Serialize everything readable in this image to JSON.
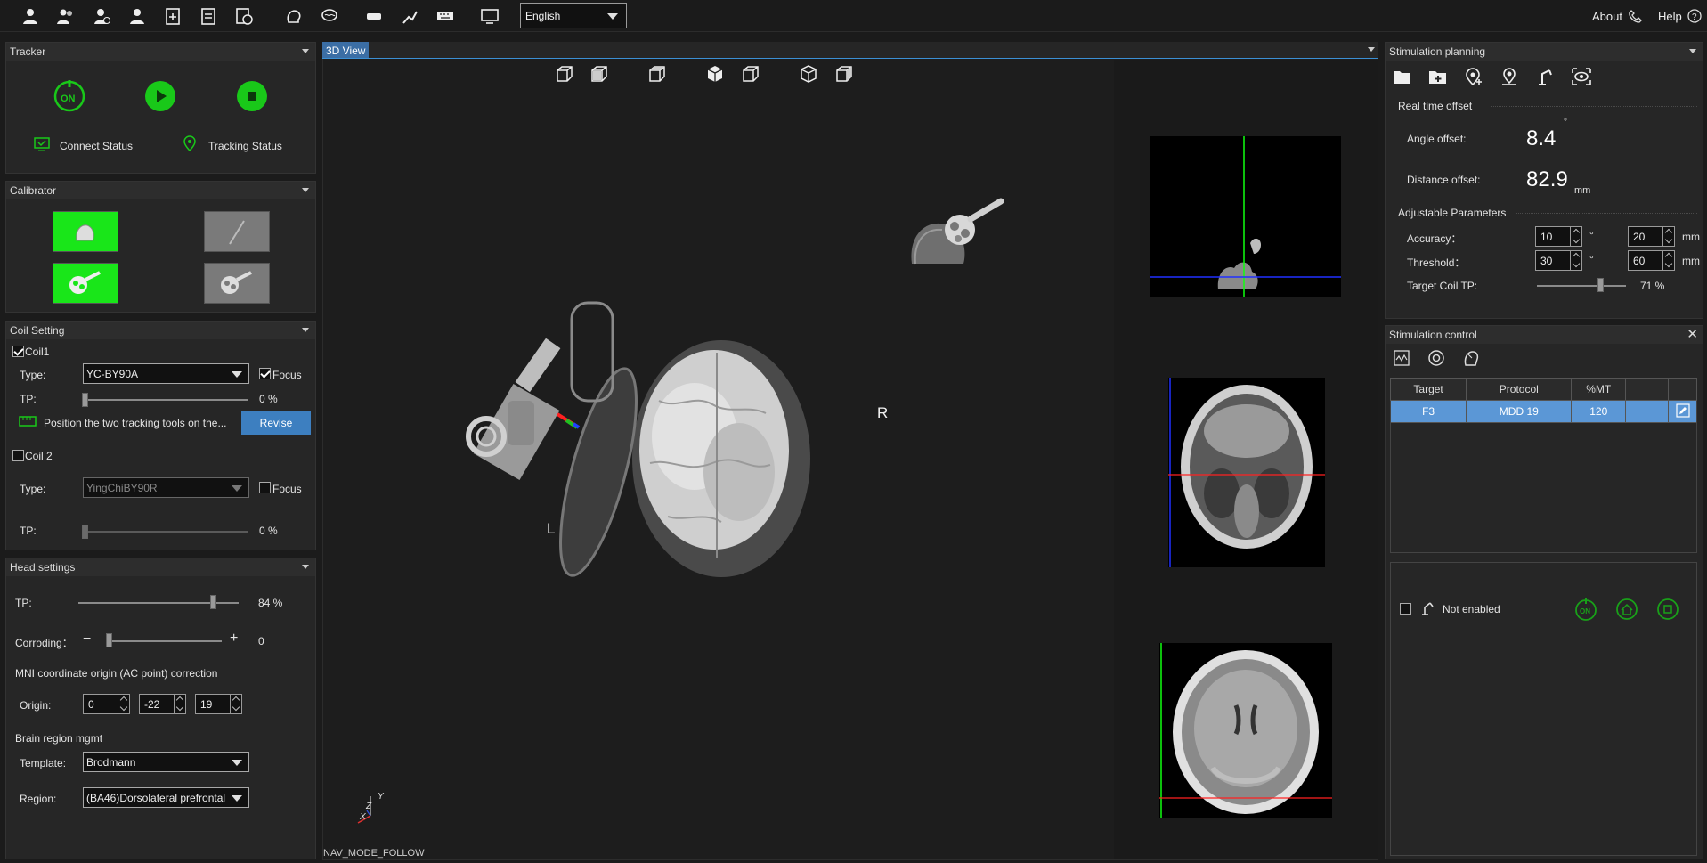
{
  "toolbar": {
    "icons": [
      "patient-icon",
      "patient-group-icon",
      "patient-add-icon",
      "patient-edit-icon",
      "new-plan-icon",
      "report-icon",
      "history-icon",
      "head-model-icon",
      "brain-icon",
      "coil-icon",
      "robot-arm-icon",
      "keyboard-icon",
      "screen-settings-icon"
    ],
    "language": "English",
    "about": "About",
    "help": "Help"
  },
  "tracker": {
    "title": "Tracker",
    "connect_status": "Connect Status",
    "tracking_status": "Tracking Status",
    "power_label": "ON"
  },
  "calibrator": {
    "title": "Calibrator"
  },
  "coil_setting": {
    "title": "Coil Setting",
    "coil1": {
      "label": "Coil1",
      "checked": true,
      "type_label": "Type:",
      "type_value": "YC-BY90A",
      "focus_label": "Focus",
      "focus_checked": true,
      "tp_label": "TP:",
      "tp_value": "0 %",
      "tp_level": 0,
      "hint": "Position the two tracking tools on the...",
      "revise": "Revise"
    },
    "coil2": {
      "label": "Coil 2",
      "checked": false,
      "type_label": "Type:",
      "type_value": "YingChiBY90R",
      "focus_label": "Focus",
      "focus_checked": false,
      "tp_label": "TP:",
      "tp_value": "0 %",
      "tp_level": 0
    }
  },
  "head_settings": {
    "title": "Head settings",
    "tp_label": "TP:",
    "tp_value": "84 %",
    "tp_level": 84,
    "corroding_label": "Corroding：",
    "corroding_value": "0",
    "minus": "−",
    "plus": "+",
    "mni_title": "MNI coordinate origin (AC point) correction",
    "origin_label": "Origin:",
    "origin_x": "0",
    "origin_y": "-22",
    "origin_z": "19",
    "brain_region_title": "Brain region mgmt",
    "template_label": "Template:",
    "template_value": "Brodmann",
    "region_label": "Region:",
    "region_value": "(BA46)Dorsolateral prefrontal"
  },
  "view3d": {
    "tab": "3D View",
    "label_left": "L",
    "label_right": "R",
    "nav_mode": "NAV_MODE_FOLLOW",
    "axis_x": "X",
    "axis_y": "Y",
    "axis_z": "Z"
  },
  "stim_planning": {
    "title": "Stimulation planning",
    "toolbar_icons": [
      "open-folder-icon",
      "add-folder-icon",
      "target-add-icon",
      "target-location-icon",
      "robot-arm-icon",
      "eye-view-icon"
    ],
    "realtime_title": "Real time offset",
    "angle_label": "Angle offset:",
    "angle_value": "8.4",
    "angle_unit": "°",
    "distance_label": "Distance offset:",
    "distance_value": "82.9",
    "distance_unit": "mm",
    "adjustable_title": "Adjustable Parameters",
    "accuracy_label": "Accuracy：",
    "accuracy_deg": "10",
    "accuracy_mm": "20",
    "threshold_label": "Threshold：",
    "threshold_deg": "30",
    "threshold_mm": "60",
    "deg_unit": "°",
    "mm_unit": "mm",
    "target_coil_label": "Target Coil TP:",
    "target_coil_value": "71 %",
    "target_coil_level": 71
  },
  "stim_control": {
    "title": "Stimulation control",
    "columns": [
      "Target",
      "Protocol",
      "%MT",
      ""
    ],
    "rows": [
      [
        "F3",
        "MDD 19",
        "120",
        ""
      ]
    ],
    "not_enabled": "Not enabled",
    "on_label": "ON"
  },
  "colors": {
    "accent_green": "#19c819",
    "selection_blue": "#5b97d6",
    "revise_blue": "#3d7fc0"
  }
}
